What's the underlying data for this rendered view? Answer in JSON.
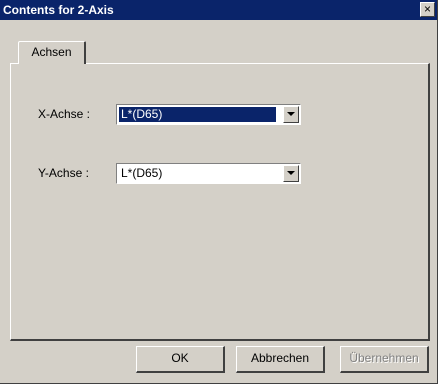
{
  "window": {
    "title": "Contents for 2-Axis",
    "close_glyph": "×"
  },
  "tabs": [
    {
      "label": "Achsen"
    }
  ],
  "fields": {
    "x_axis": {
      "label": "X-Achse :",
      "value": "L*(D65)"
    },
    "y_axis": {
      "label": "Y-Achse :",
      "value": "L*(D65)"
    }
  },
  "buttons": {
    "ok": "OK",
    "cancel": "Abbrechen",
    "apply": "Übernehmen"
  },
  "colors": {
    "titlebar": "#0a246a",
    "face": "#d4d0c8",
    "selection": "#0a246a"
  },
  "icons": [
    "close-icon",
    "chevron-down-icon"
  ]
}
